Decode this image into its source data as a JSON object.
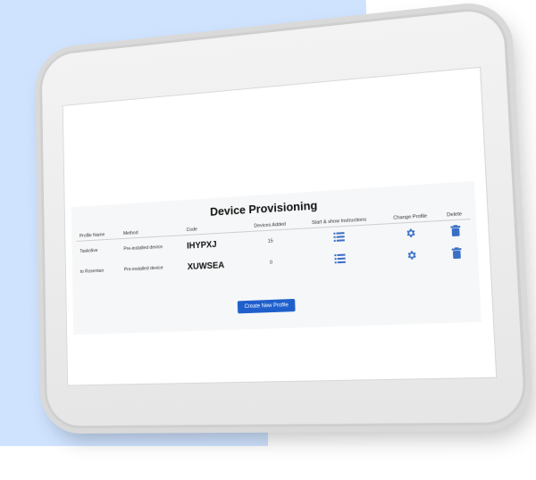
{
  "page": {
    "title": "Device Provisioning"
  },
  "table": {
    "headers": {
      "profile_name": "Profile Name",
      "method": "Method",
      "code": "Code",
      "devices_added": "Devices Added",
      "start_show": "Start & show Instructions",
      "change_profile": "Change Profile",
      "delete": "Delete"
    },
    "rows": [
      {
        "profile_name": "Taskolive",
        "method": "Pre-installed device",
        "code": "IHYPXJ",
        "devices_added": "15"
      },
      {
        "profile_name": "to Rosentan",
        "method": "Pre-installed device",
        "code": "XUWSEA",
        "devices_added": "0"
      }
    ]
  },
  "actions": {
    "create_profile": "Create New Profile"
  },
  "colors": {
    "accent": "#1f5fcc",
    "icon_blue": "#3a6fc6",
    "background_blob": "#cfe3ff"
  },
  "icons": {
    "start_show": "list-icon",
    "change_profile": "gear-icon",
    "delete": "trash-icon"
  }
}
